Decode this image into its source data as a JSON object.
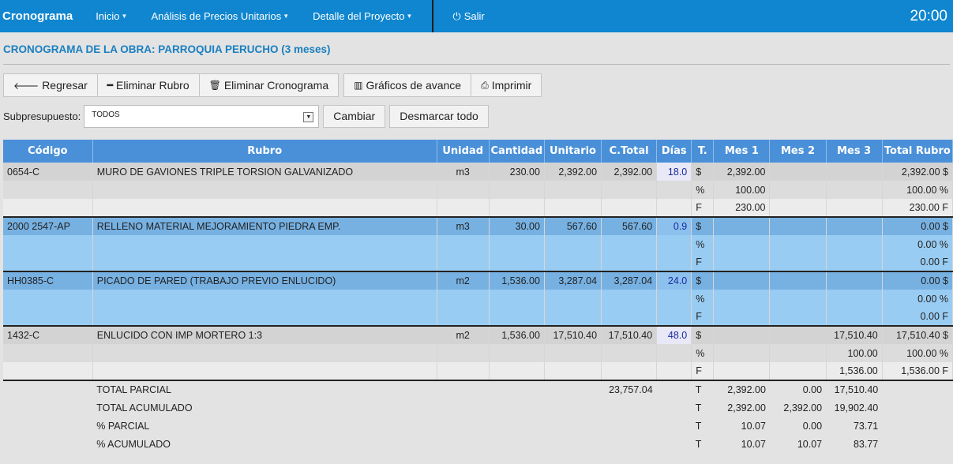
{
  "nav": {
    "brand": "Cronograma",
    "items": [
      "Inicio",
      "Análisis de Precios Unitarios",
      "Detalle del Proyecto"
    ],
    "exit": "Salir",
    "clock": "20:00"
  },
  "title": "CRONOGRAMA DE LA OBRA: PARROQUIA PERUCHO (3 meses)",
  "toolbar": {
    "regresar": "Regresar",
    "eliminar_rubro": "Eliminar Rubro",
    "eliminar_cronograma": "Eliminar Cronograma",
    "graficos": "Gráficos de avance",
    "imprimir": "Imprimir"
  },
  "filter": {
    "label": "Subpresupuesto:",
    "value": "TODOS",
    "cambiar": "Cambiar",
    "desmarcar": "Desmarcar todo"
  },
  "headers": [
    "Código",
    "Rubro",
    "Unidad",
    "Cantidad",
    "Unitario",
    "C.Total",
    "Días",
    "T.",
    "Mes 1",
    "Mes 2",
    "Mes 3",
    "Total Rubro"
  ],
  "rubros": [
    {
      "codigo": "0654-C",
      "rubro": "MURO DE GAVIONES TRIPLE TORSION GALVANIZADO",
      "unidad": "m3",
      "cantidad": "230.00",
      "unitario": "2,392.00",
      "ctotal": "2,392.00",
      "dias": "18.0",
      "rows": [
        [
          "$",
          "2,392.00",
          "",
          "",
          "2,392.00 $"
        ],
        [
          "%",
          "100.00",
          "",
          "",
          "100.00 %"
        ],
        [
          "F",
          "230.00",
          "",
          "",
          "230.00 F"
        ]
      ]
    },
    {
      "codigo": "2000 2547-AP",
      "rubro": "RELLENO MATERIAL MEJORAMIENTO PIEDRA EMP.",
      "unidad": "m3",
      "cantidad": "30.00",
      "unitario": "567.60",
      "ctotal": "567.60",
      "dias": "0.9",
      "rows": [
        [
          "$",
          "",
          "",
          "",
          "0.00 $"
        ],
        [
          "%",
          "",
          "",
          "",
          "0.00 %"
        ],
        [
          "F",
          "",
          "",
          "",
          "0.00 F"
        ]
      ]
    },
    {
      "codigo": "HH0385-C",
      "rubro": "PICADO DE PARED (TRABAJO PREVIO ENLUCIDO)",
      "unidad": "m2",
      "cantidad": "1,536.00",
      "unitario": "3,287.04",
      "ctotal": "3,287.04",
      "dias": "24.0",
      "rows": [
        [
          "$",
          "",
          "",
          "",
          "0.00 $"
        ],
        [
          "%",
          "",
          "",
          "",
          "0.00 %"
        ],
        [
          "F",
          "",
          "",
          "",
          "0.00 F"
        ]
      ]
    },
    {
      "codigo": "1432-C",
      "rubro": "ENLUCIDO CON IMP MORTERO 1:3",
      "unidad": "m2",
      "cantidad": "1,536.00",
      "unitario": "17,510.40",
      "ctotal": "17,510.40",
      "dias": "48.0",
      "rows": [
        [
          "$",
          "",
          "",
          "17,510.40",
          "17,510.40 $"
        ],
        [
          "%",
          "",
          "",
          "100.00",
          "100.00 %"
        ],
        [
          "F",
          "",
          "",
          "1,536.00",
          "1,536.00 F"
        ]
      ]
    }
  ],
  "totals": [
    {
      "label": "TOTAL PARCIAL",
      "ctotal": "23,757.04",
      "t": "T",
      "m1": "2,392.00",
      "m2": "0.00",
      "m3": "17,510.40"
    },
    {
      "label": "TOTAL ACUMULADO",
      "ctotal": "",
      "t": "T",
      "m1": "2,392.00",
      "m2": "2,392.00",
      "m3": "19,902.40"
    },
    {
      "label": "% PARCIAL",
      "ctotal": "",
      "t": "T",
      "m1": "10.07",
      "m2": "0.00",
      "m3": "73.71"
    },
    {
      "label": "% ACUMULADO",
      "ctotal": "",
      "t": "T",
      "m1": "10.07",
      "m2": "10.07",
      "m3": "83.77"
    }
  ]
}
